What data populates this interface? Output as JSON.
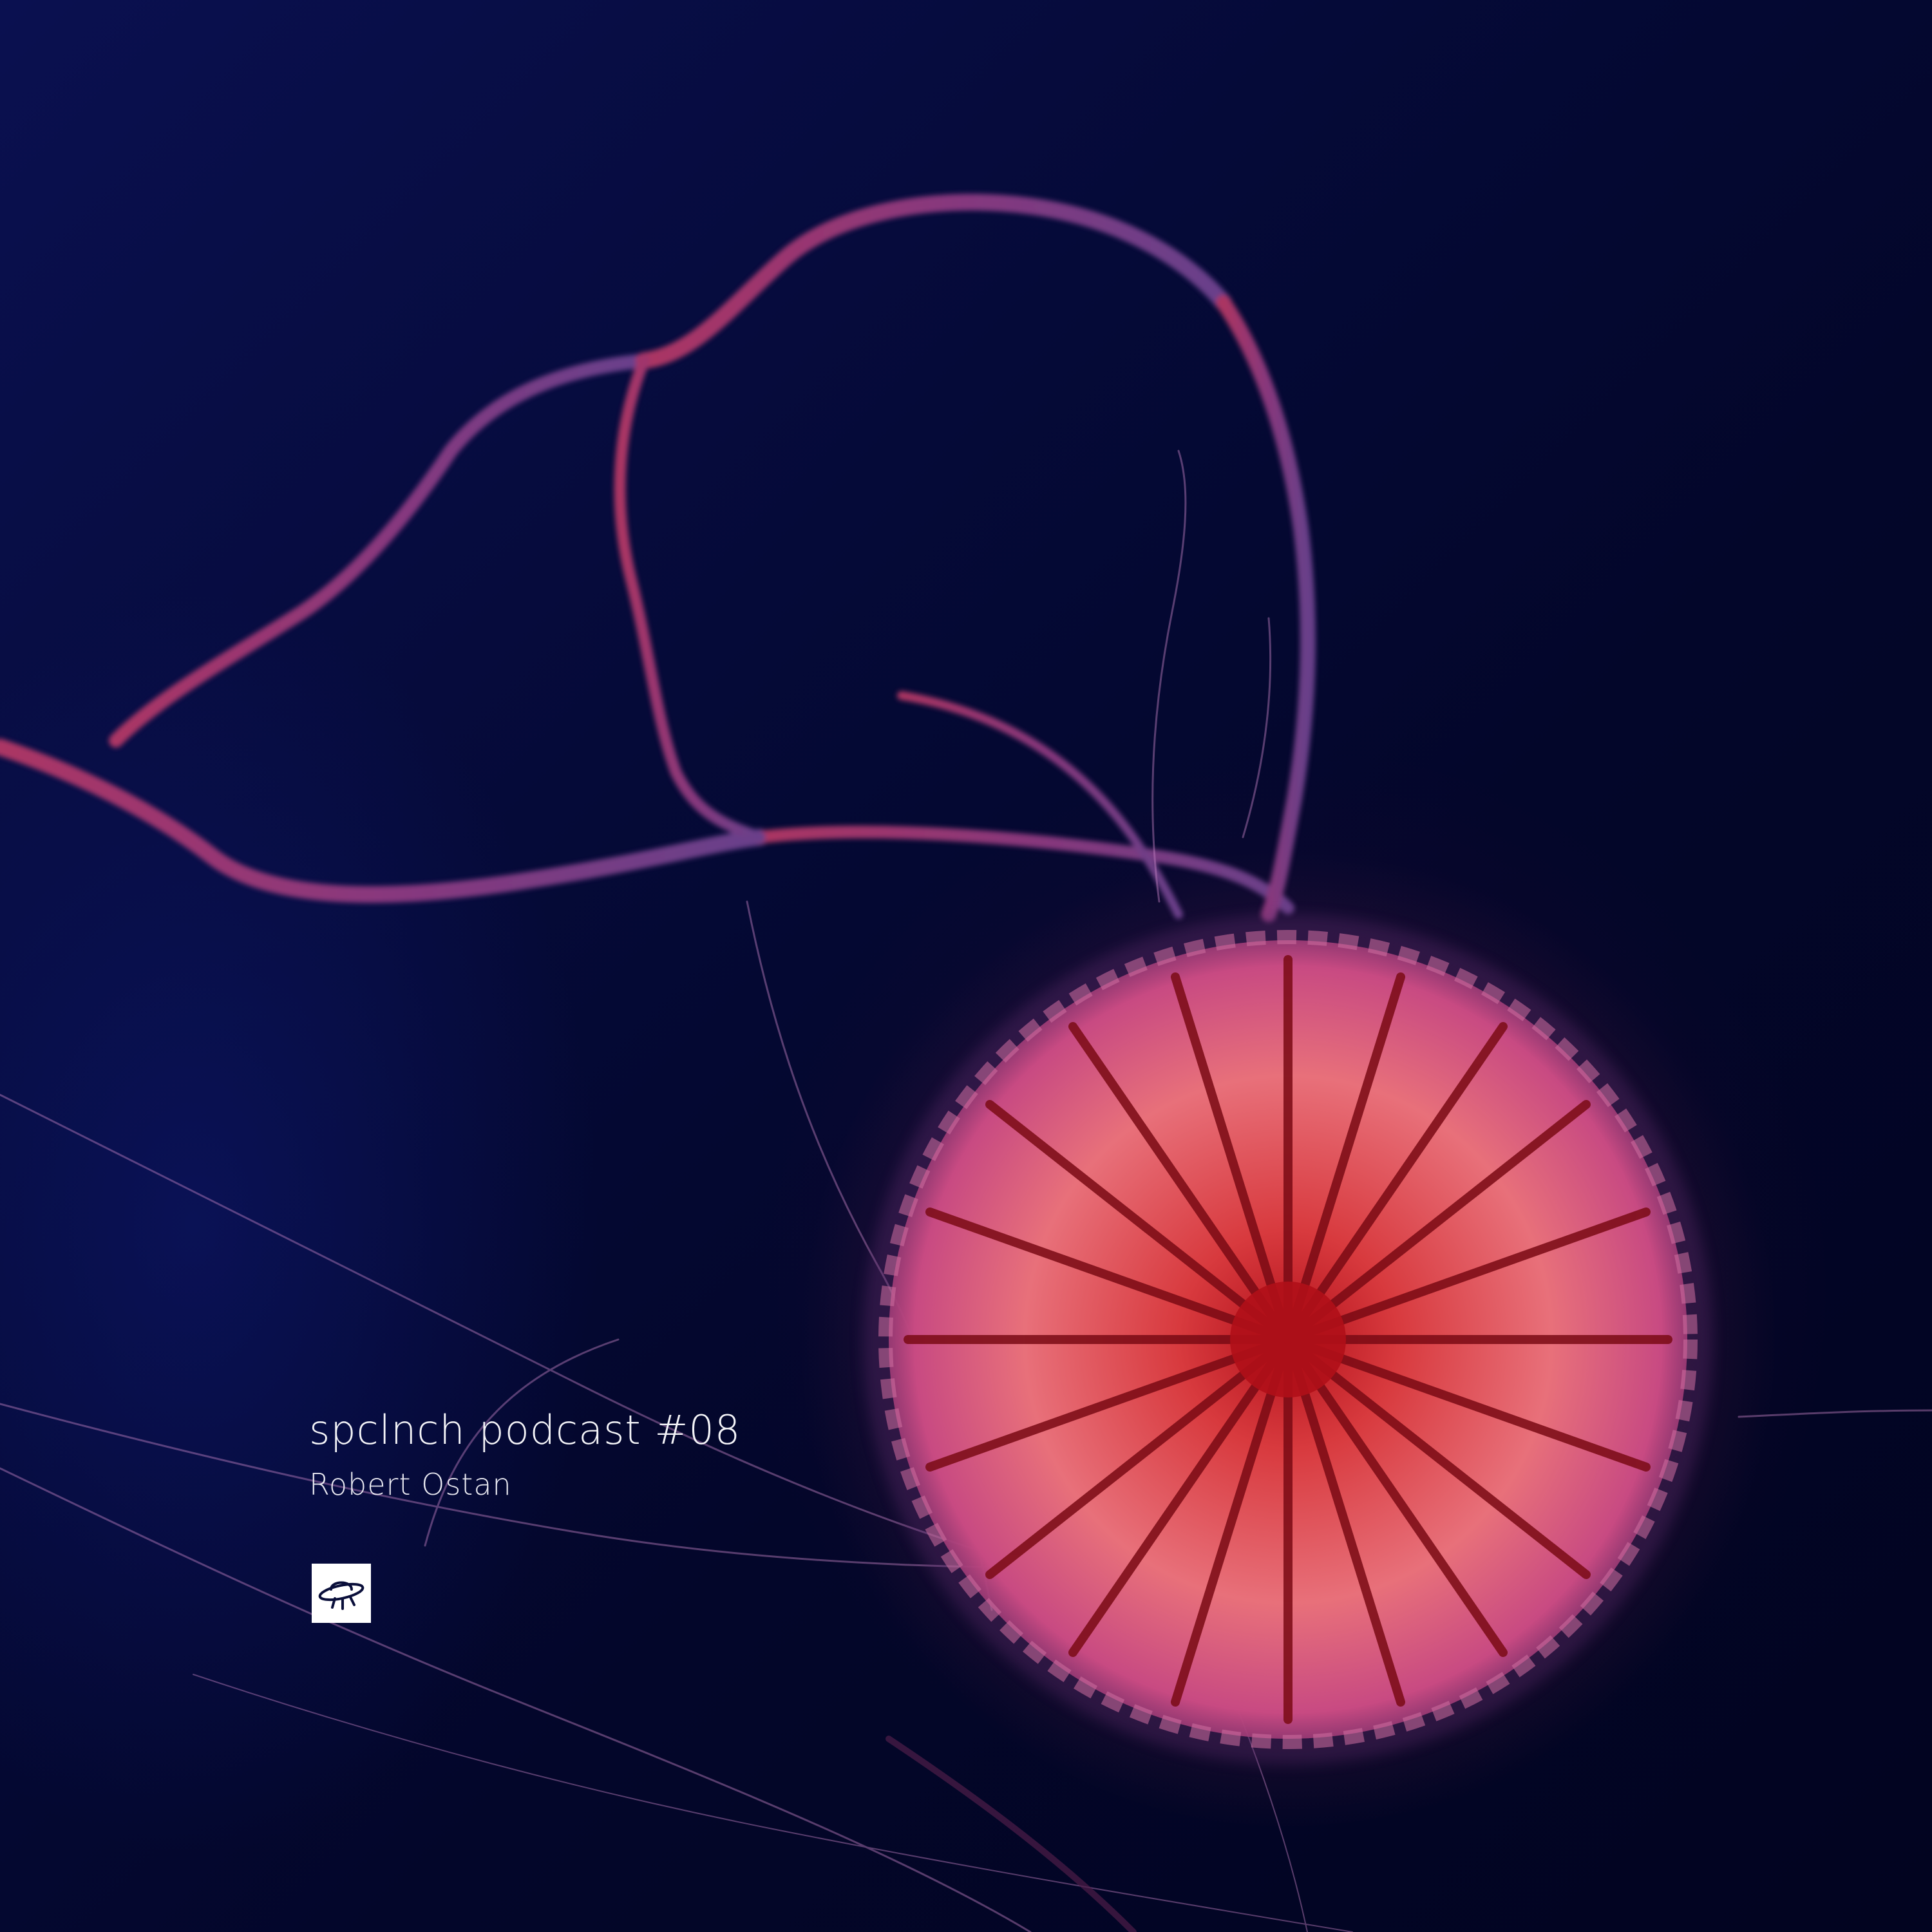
{
  "cover": {
    "episode_title": "spclnch podcast #08",
    "artist": "Robert Ostan",
    "logo_icon": "ufo-icon",
    "scene": "jellyfish-photo",
    "colors": {
      "background": "#03062a",
      "jellyfish_bell": "#e0405a",
      "jellyfish_center": "#c21a24",
      "tentacles": "#c03a78",
      "text": "#ffffff",
      "logo_bg": "#ffffff",
      "logo_fg": "#0a0f3a"
    }
  }
}
